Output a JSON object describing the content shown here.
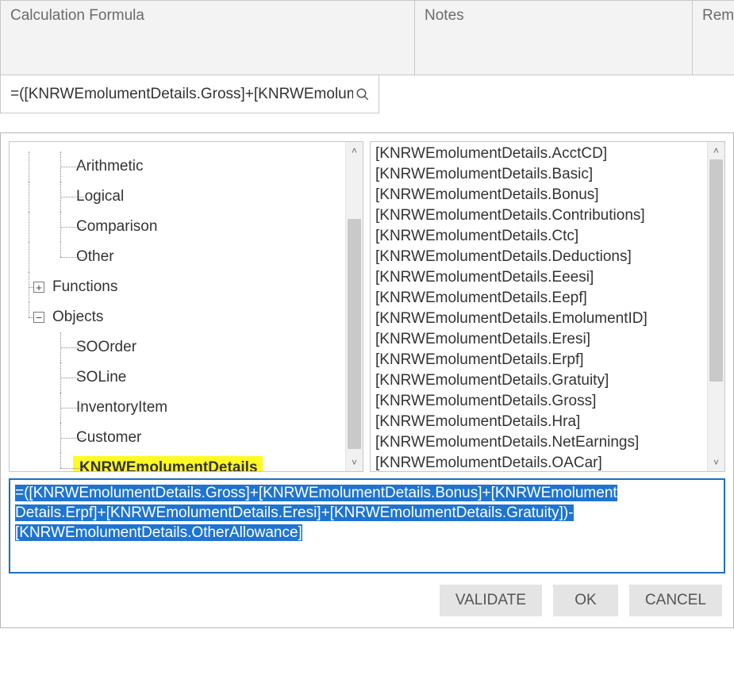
{
  "header": {
    "formula_col": "Calculation Formula",
    "notes_col": "Notes",
    "rem_col": "Rem"
  },
  "search": {
    "text": "=([KNRWEmolumentDetails.Gross]+[KNRWEmolum"
  },
  "tree": {
    "ops": {
      "arithmetic": "Arithmetic",
      "logical": "Logical",
      "comparison": "Comparison",
      "other": "Other"
    },
    "functions": "Functions",
    "objects": {
      "label": "Objects",
      "items": {
        "soorder": "SOOrder",
        "soline": "SOLine",
        "inventoryitem": "InventoryItem",
        "customer": "Customer",
        "knrwemolumentdetails": "KNRWEmolumentDetails"
      }
    },
    "expand_glyph_plus": "+",
    "expand_glyph_minus": "−"
  },
  "fields": [
    "[KNRWEmolumentDetails.AcctCD]",
    "[KNRWEmolumentDetails.Basic]",
    "[KNRWEmolumentDetails.Bonus]",
    "[KNRWEmolumentDetails.Contributions]",
    "[KNRWEmolumentDetails.Ctc]",
    "[KNRWEmolumentDetails.Deductions]",
    "[KNRWEmolumentDetails.Eeesi]",
    "[KNRWEmolumentDetails.Eepf]",
    "[KNRWEmolumentDetails.EmolumentID]",
    "[KNRWEmolumentDetails.Eresi]",
    "[KNRWEmolumentDetails.Erpf]",
    "[KNRWEmolumentDetails.Gratuity]",
    "[KNRWEmolumentDetails.Gross]",
    "[KNRWEmolumentDetails.Hra]",
    "[KNRWEmolumentDetails.NetEarnings]",
    "[KNRWEmolumentDetails.OACar]"
  ],
  "formula": {
    "line1": "=([KNRWEmolumentDetails.Gross]+[KNRWEmolumentDetails.Bonus]+[KNRWEmolument",
    "line2": "Details.Erpf]+[KNRWEmolumentDetails.Eresi]+[KNRWEmolumentDetails.Gratuity])-",
    "line3": "[KNRWEmolumentDetails.OtherAllowance]"
  },
  "buttons": {
    "validate": "VALIDATE",
    "ok": "OK",
    "cancel": "CANCEL"
  },
  "scroll": {
    "up_glyph": "˄",
    "down_glyph": "˅"
  }
}
